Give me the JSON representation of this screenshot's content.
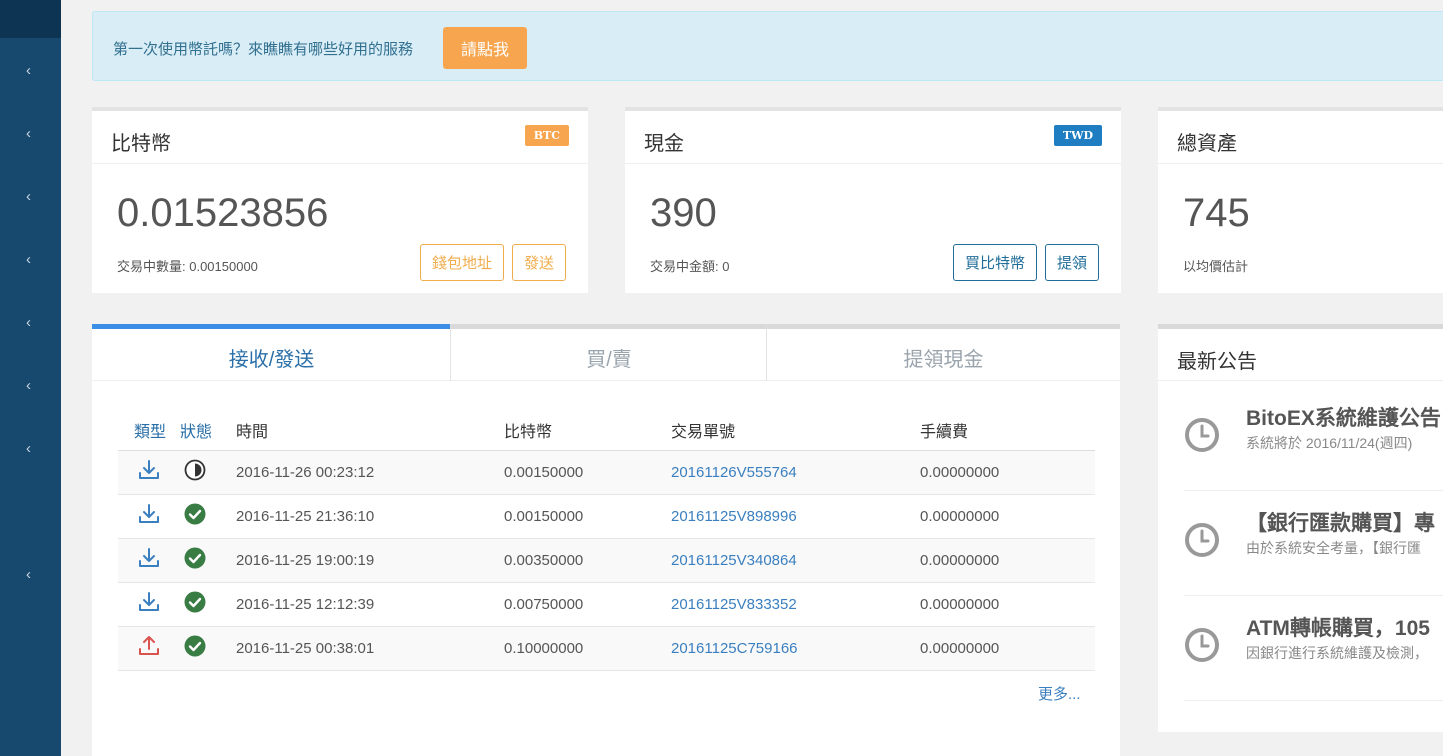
{
  "notice": {
    "text": "第一次使用幣託嗎？來瞧瞧有哪些好用的服務",
    "button": "請點我"
  },
  "cards": {
    "btc": {
      "title": "比特幣",
      "badge": "BTC",
      "amount": "0.01523856",
      "sub": "交易中數量: 0.00150000",
      "btn1": "錢包地址",
      "btn2": "發送"
    },
    "cash": {
      "title": "現金",
      "badge": "TWD",
      "amount": "390",
      "sub": "交易中金額: 0",
      "btn1": "買比特幣",
      "btn2": "提領"
    },
    "total": {
      "title": "總資產",
      "amount": "745",
      "sub": "以均價估計"
    }
  },
  "tabs": [
    "接收/發送",
    "買/賣",
    "提領現金"
  ],
  "table": {
    "headers": {
      "type": "類型",
      "status": "狀態",
      "time": "時間",
      "btc": "比特幣",
      "id": "交易單號",
      "fee": "手續費"
    },
    "rows": [
      {
        "dir": "receive",
        "status": "pending",
        "time": "2016-11-26 00:23:12",
        "btc": "0.00150000",
        "id": "20161126V555764",
        "fee": "0.00000000"
      },
      {
        "dir": "receive",
        "status": "done",
        "time": "2016-11-25 21:36:10",
        "btc": "0.00150000",
        "id": "20161125V898996",
        "fee": "0.00000000"
      },
      {
        "dir": "receive",
        "status": "done",
        "time": "2016-11-25 19:00:19",
        "btc": "0.00350000",
        "id": "20161125V340864",
        "fee": "0.00000000"
      },
      {
        "dir": "receive",
        "status": "done",
        "time": "2016-11-25 12:12:39",
        "btc": "0.00750000",
        "id": "20161125V833352",
        "fee": "0.00000000"
      },
      {
        "dir": "send",
        "status": "done",
        "time": "2016-11-25 00:38:01",
        "btc": "0.10000000",
        "id": "20161125C759166",
        "fee": "0.00000000"
      }
    ],
    "more": "更多..."
  },
  "news": {
    "title": "最新公告",
    "items": [
      {
        "title": "BitoEX系統維護公告",
        "desc": "系統將於 2016/11/24(週四)"
      },
      {
        "title": "【銀行匯款購買】專",
        "desc": "由於系統安全考量，【銀行匯"
      },
      {
        "title": "ATM轉帳購買，105",
        "desc": "因銀行進行系統維護及檢測，"
      }
    ]
  },
  "colors": {
    "sidebar": "#17486d",
    "accent_orange": "#f7a54e",
    "accent_blue": "#1f6d98",
    "success": "#3a7d44",
    "send_red": "#d9534f"
  }
}
